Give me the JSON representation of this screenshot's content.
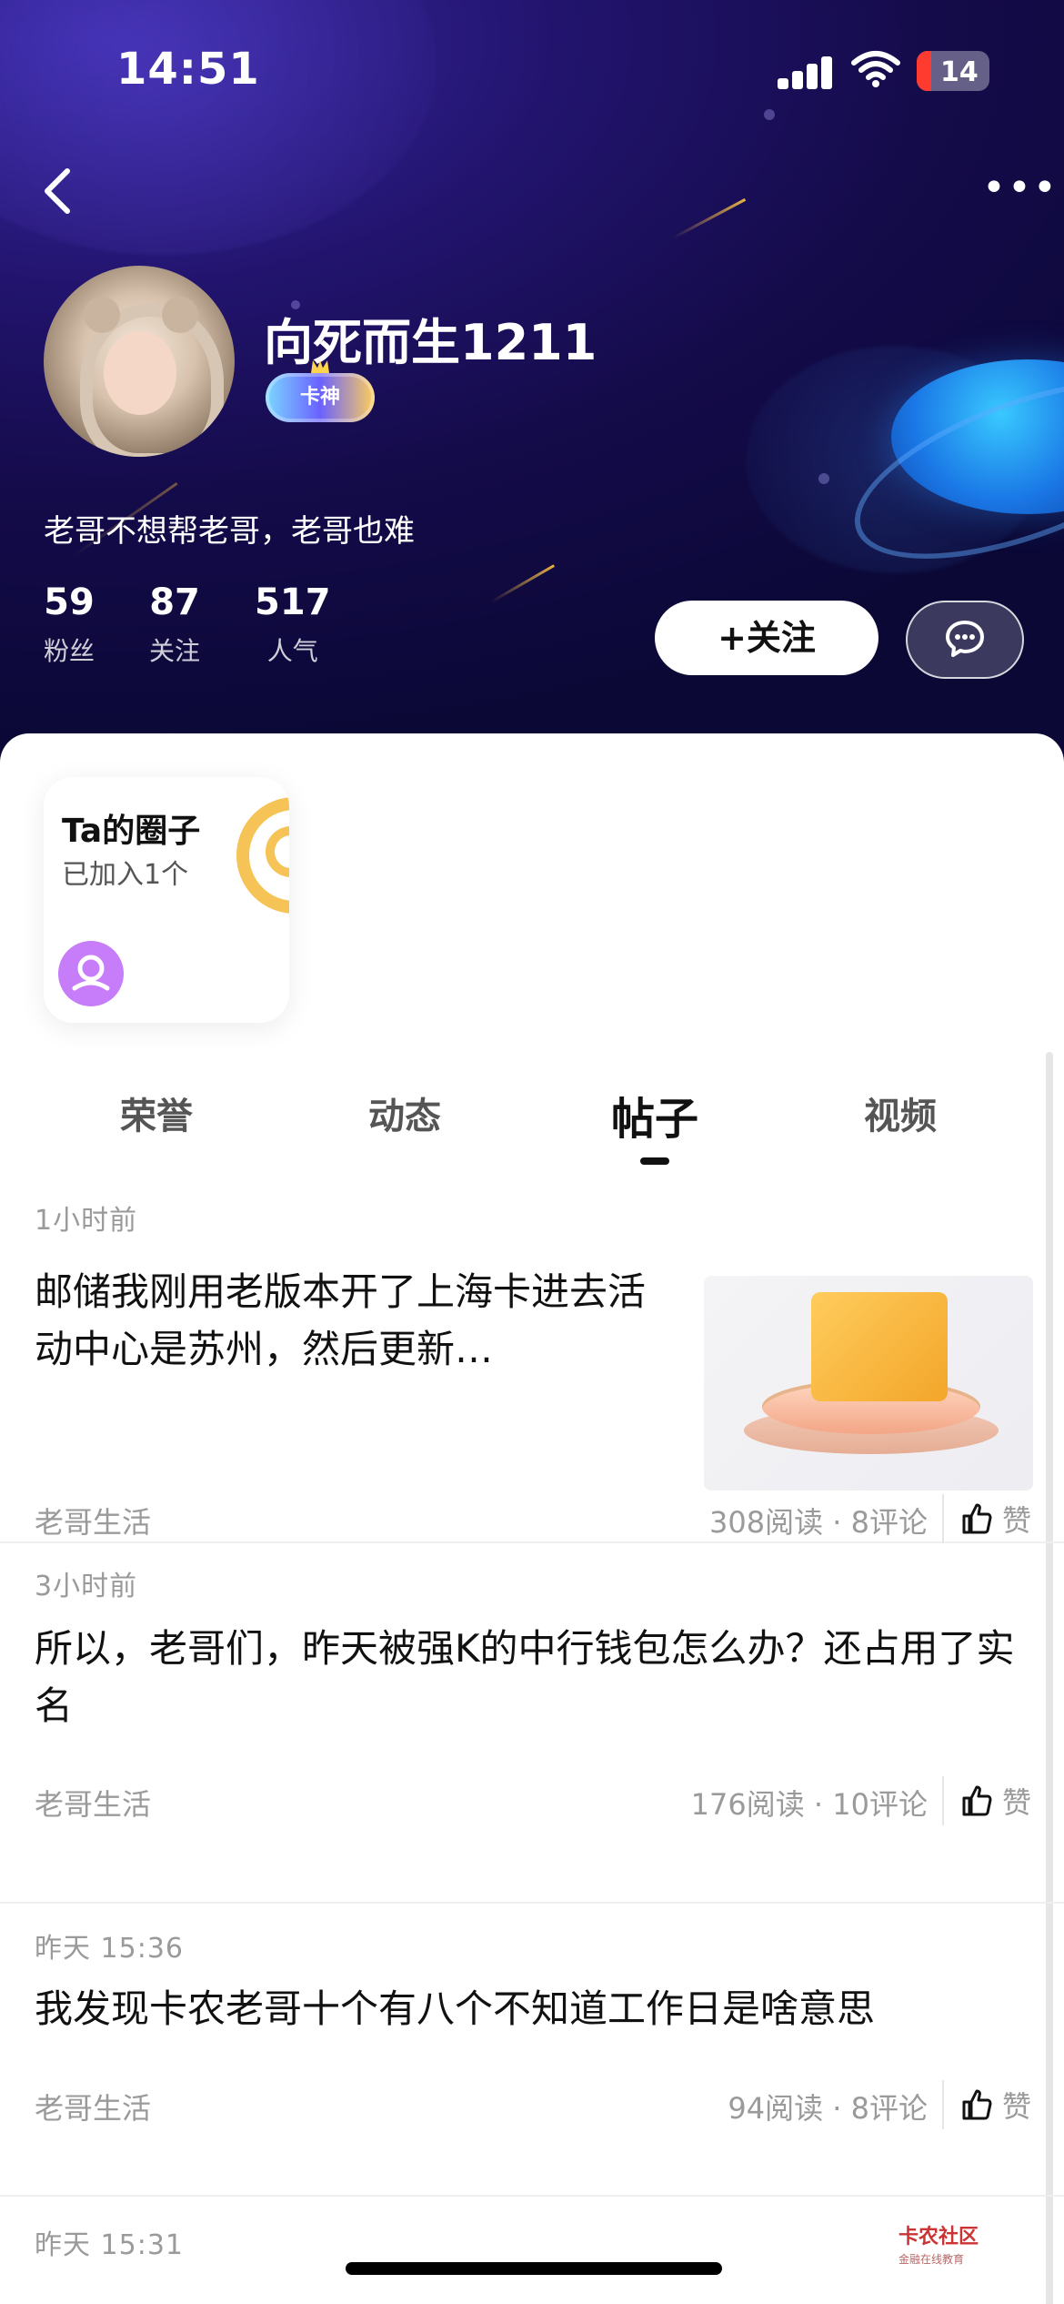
{
  "status_bar": {
    "time": "14:51",
    "battery": "14"
  },
  "profile": {
    "username": "向死而生1211",
    "badge": "卡神",
    "bio": "老哥不想帮老哥，老哥也难",
    "stats": [
      {
        "num": "59",
        "label": "粉丝"
      },
      {
        "num": "87",
        "label": "关注"
      },
      {
        "num": "517",
        "label": "人气"
      }
    ],
    "follow_label": "+关注"
  },
  "circle_card": {
    "title": "Ta的圈子",
    "subtitle": "已加入1个"
  },
  "tabs": [
    {
      "label": "荣誉"
    },
    {
      "label": "动态"
    },
    {
      "label": "帖子"
    },
    {
      "label": "视频"
    }
  ],
  "posts": [
    {
      "time": "1小时前",
      "title": "邮储我刚用老版本开了上海卡进去活动中心是苏州，然后更新…",
      "category": "老哥生活",
      "reads": "308阅读",
      "comments": "8评论",
      "like_label": "赞"
    },
    {
      "time": "3小时前",
      "title": "所以，老哥们，昨天被强K的中行钱包怎么办？还占用了实名",
      "category": "老哥生活",
      "reads": "176阅读",
      "comments": "10评论",
      "like_label": "赞"
    },
    {
      "time": "昨天 15:36",
      "title": "我发现卡农老哥十个有八个不知道工作日是啥意思",
      "category": "老哥生活",
      "reads": "94阅读",
      "comments": "8评论",
      "like_label": "赞"
    },
    {
      "time": "昨天 15:31"
    }
  ],
  "watermark": {
    "title": "卡农社区",
    "subtitle": "金融在线教育"
  },
  "colors": {
    "accent_follow": "#ffffff",
    "tab_active": "#111111",
    "muted": "#9a9a9a",
    "card_badge": "#c77dfa",
    "hero_bg": "#22146e"
  }
}
